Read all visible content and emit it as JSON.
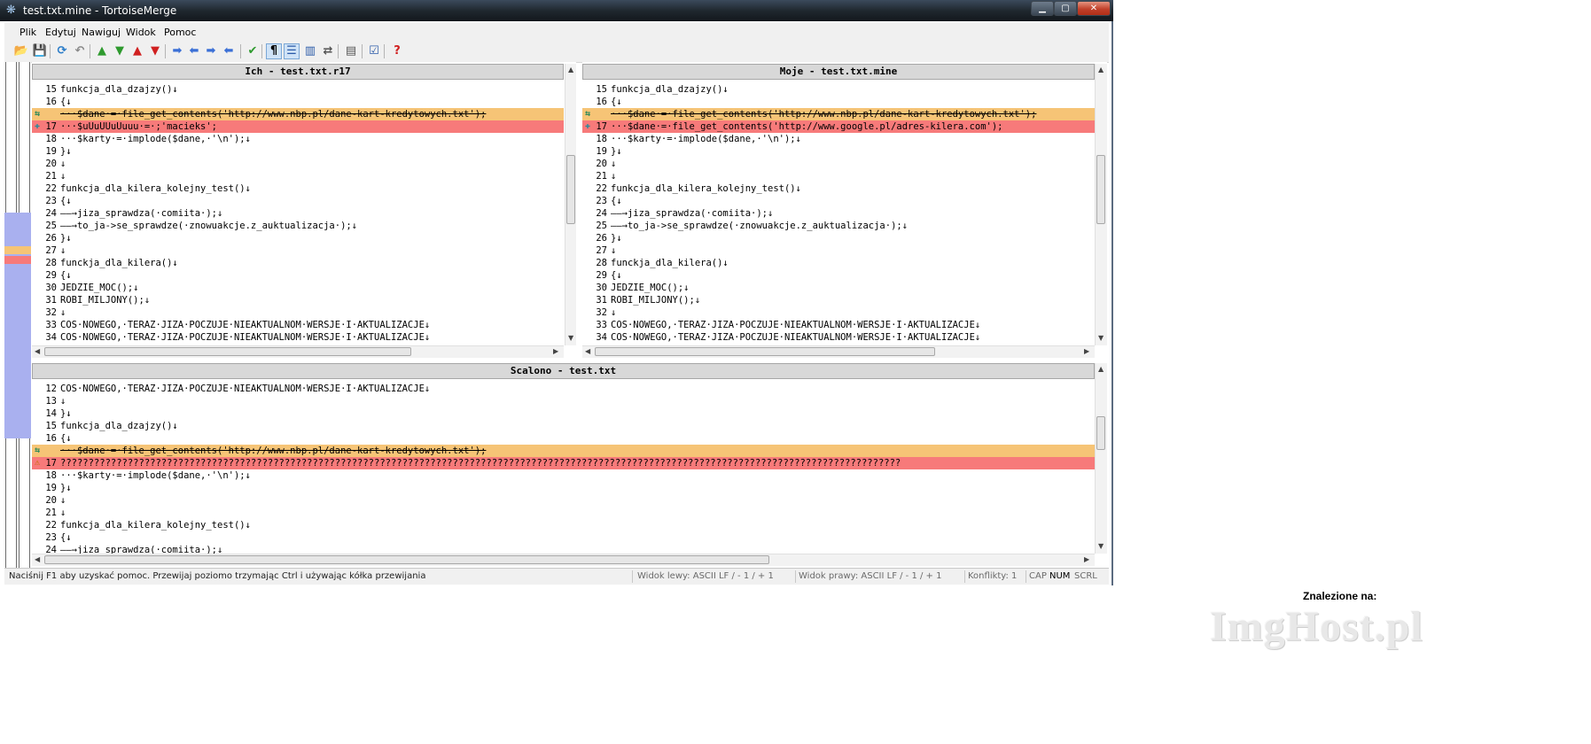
{
  "window": {
    "title": "test.txt.mine - TortoiseMerge",
    "min_glyph": "▁",
    "max_glyph": "▢",
    "close_glyph": "✕"
  },
  "menu": [
    "Plik",
    "Edytuj",
    "Nawiguj",
    "Widok",
    "Pomoc"
  ],
  "toolbar": [
    {
      "icon": "open-folder-icon",
      "glyph": "📂",
      "color": "#d9a400"
    },
    {
      "icon": "save-icon",
      "glyph": "💾",
      "color": "#2a5aa8"
    },
    {
      "icon": "reload-icon",
      "glyph": "⟳",
      "color": "#2a7cc8"
    },
    {
      "icon": "undo-icon",
      "glyph": "↶",
      "color": "#8a8a8a"
    },
    {
      "icon": "next-diff-icon",
      "glyph": "▲",
      "color": "#2e9a2e"
    },
    {
      "icon": "prev-diff-icon",
      "glyph": "▼",
      "color": "#2e9a2e"
    },
    {
      "icon": "prev-conflict-icon",
      "glyph": "▲",
      "color": "#d02020"
    },
    {
      "icon": "next-conflict-icon",
      "glyph": "▼",
      "color": "#d02020"
    },
    {
      "icon": "use-theirs-block-icon",
      "glyph": "➡",
      "color": "#3a6fd6"
    },
    {
      "icon": "use-mine-block-icon",
      "glyph": "⬅",
      "color": "#3a6fd6"
    },
    {
      "icon": "use-theirs-then-mine-icon",
      "glyph": "➡",
      "color": "#3a6fd6"
    },
    {
      "icon": "use-mine-then-theirs-icon",
      "glyph": "⬅",
      "color": "#3a6fd6"
    },
    {
      "icon": "mark-resolved-icon",
      "glyph": "✔",
      "color": "#2e9a2e"
    },
    {
      "icon": "whitespace-icon",
      "glyph": "¶",
      "color": "#000000"
    },
    {
      "icon": "one-pane-view-icon",
      "glyph": "☰",
      "color": "#2a5aa8"
    },
    {
      "icon": "two-pane-view-icon",
      "glyph": "▥",
      "color": "#2a5aa8"
    },
    {
      "icon": "switch-views-icon",
      "glyph": "⇄",
      "color": "#555555"
    },
    {
      "icon": "line-diff-icon",
      "glyph": "▤",
      "color": "#555555"
    },
    {
      "icon": "settings-icon",
      "glyph": "☑",
      "color": "#2a5aa8"
    },
    {
      "icon": "help-icon",
      "glyph": "?",
      "color": "#d02020"
    }
  ],
  "panes": {
    "theirs": {
      "title": "Ich - test.txt.r17",
      "lines": [
        {
          "n": "15",
          "t": "funkcja_dla_dzajzy()↓"
        },
        {
          "n": "16",
          "t": "{↓"
        },
        {
          "n": "",
          "t": "···$dane·=·file_get_contents('http://www.nbp.pl/dane-kart-kredytowych.txt');",
          "cls": "conf",
          "icon": "⇆"
        },
        {
          "n": "17",
          "t": "···$uUuUUuUuuu·=·;'macieks';",
          "cls": "add",
          "icon": "✚"
        },
        {
          "n": "18",
          "t": "···$karty·=·implode($dane,·'\\n');↓"
        },
        {
          "n": "19",
          "t": "}↓"
        },
        {
          "n": "20",
          "t": "↓"
        },
        {
          "n": "21",
          "t": "↓"
        },
        {
          "n": "22",
          "t": "funkcja_dla_kilera_kolejny_test()↓"
        },
        {
          "n": "23",
          "t": "{↓"
        },
        {
          "n": "24",
          "t": "——→jiza_sprawdza(·comiita·);↓"
        },
        {
          "n": "25",
          "t": "——→to_ja->se_sprawdze(·znowuakcje.z_auktualizacja·);↓"
        },
        {
          "n": "26",
          "t": "}↓"
        },
        {
          "n": "27",
          "t": "↓"
        },
        {
          "n": "28",
          "t": "funckja_dla_kilera()↓"
        },
        {
          "n": "29",
          "t": "{↓"
        },
        {
          "n": "30",
          "t": "JEDZIE_MOC();↓"
        },
        {
          "n": "31",
          "t": "ROBI_MILJONY();↓"
        },
        {
          "n": "32",
          "t": "↓"
        },
        {
          "n": "33",
          "t": "COS·NOWEGO,·TERAZ·JIZA·POCZUJE·NIEAKTUALNOM·WERSJE·I·AKTUALIZACJE↓"
        },
        {
          "n": "34",
          "t": "COS·NOWEGO,·TERAZ·JIZA·POCZUJE·NIEAKTUALNOM·WERSJE·I·AKTUALIZACJE↓"
        }
      ]
    },
    "mine": {
      "title": "Moje - test.txt.mine",
      "lines": [
        {
          "n": "15",
          "t": "funkcja_dla_dzajzy()↓"
        },
        {
          "n": "16",
          "t": "{↓"
        },
        {
          "n": "",
          "t": "···$dane·=·file_get_contents('http://www.nbp.pl/dane-kart-kredytowych.txt');",
          "cls": "conf",
          "icon": "⇆"
        },
        {
          "n": "17",
          "t": "···$dane·=·file_get_contents('http://www.google.pl/adres-kilera.com');",
          "cls": "add",
          "icon": "✚"
        },
        {
          "n": "18",
          "t": "···$karty·=·implode($dane,·'\\n');↓"
        },
        {
          "n": "19",
          "t": "}↓"
        },
        {
          "n": "20",
          "t": "↓"
        },
        {
          "n": "21",
          "t": "↓"
        },
        {
          "n": "22",
          "t": "funkcja_dla_kilera_kolejny_test()↓"
        },
        {
          "n": "23",
          "t": "{↓"
        },
        {
          "n": "24",
          "t": "——→jiza_sprawdza(·comiita·);↓"
        },
        {
          "n": "25",
          "t": "——→to_ja->se_sprawdze(·znowuakcje.z_auktualizacja·);↓"
        },
        {
          "n": "26",
          "t": "}↓"
        },
        {
          "n": "27",
          "t": "↓"
        },
        {
          "n": "28",
          "t": "funckja_dla_kilera()↓"
        },
        {
          "n": "29",
          "t": "{↓"
        },
        {
          "n": "30",
          "t": "JEDZIE_MOC();↓"
        },
        {
          "n": "31",
          "t": "ROBI_MILJONY();↓"
        },
        {
          "n": "32",
          "t": "↓"
        },
        {
          "n": "33",
          "t": "COS·NOWEGO,·TERAZ·JIZA·POCZUJE·NIEAKTUALNOM·WERSJE·I·AKTUALIZACJE↓"
        },
        {
          "n": "34",
          "t": "COS·NOWEGO,·TERAZ·JIZA·POCZUJE·NIEAKTUALNOM·WERSJE·I·AKTUALIZACJE↓"
        }
      ]
    },
    "merged": {
      "title": "Scalono - test.txt",
      "lines": [
        {
          "n": "12",
          "t": "COS·NOWEGO,·TERAZ·JIZA·POCZUJE·NIEAKTUALNOM·WERSJE·I·AKTUALIZACJE↓"
        },
        {
          "n": "13",
          "t": "↓"
        },
        {
          "n": "14",
          "t": "}↓"
        },
        {
          "n": "15",
          "t": "funkcja_dla_dzajzy()↓"
        },
        {
          "n": "16",
          "t": "{↓"
        },
        {
          "n": "",
          "t": "···$dane·=·file_get_contents('http://www.nbp.pl/dane-kart-kredytowych.txt');",
          "cls": "conf",
          "icon": "⇆"
        },
        {
          "n": "17",
          "t": "??????????????????????????????????????????????????????????????????????????????????????????????????????????????????????????????????????????????????????",
          "cls": "q",
          "icon": "⚠"
        },
        {
          "n": "18",
          "t": "···$karty·=·implode($dane,·'\\n');↓"
        },
        {
          "n": "19",
          "t": "}↓"
        },
        {
          "n": "20",
          "t": "↓"
        },
        {
          "n": "21",
          "t": "↓"
        },
        {
          "n": "22",
          "t": "funkcja_dla_kilera_kolejny_test()↓"
        },
        {
          "n": "23",
          "t": "{↓"
        },
        {
          "n": "24",
          "t": "——→jiza_sprawdza(·comiita·);↓"
        }
      ]
    }
  },
  "status": {
    "help": "Naciśnij F1 aby uzyskać pomoc. Przewijaj poziomo trzymając Ctrl i używając kółka przewijania",
    "left_view": "Widok lewy: ASCII LF  / - 1 / + 1",
    "right_view": "Widok prawy: ASCII LF  / - 1 / + 1",
    "conflicts": "Konflikty: 1",
    "cap": "CAP",
    "num": "NUM",
    "scrl": "SCRL"
  },
  "found_on": "Znalezione na:",
  "watermark": "ImgHost.pl",
  "colors": {
    "conflict_removed": "#f6c476",
    "changed_added": "#f77a7a",
    "locator_blue": "#a9b0ef",
    "header_gray": "#d8d8d8"
  }
}
